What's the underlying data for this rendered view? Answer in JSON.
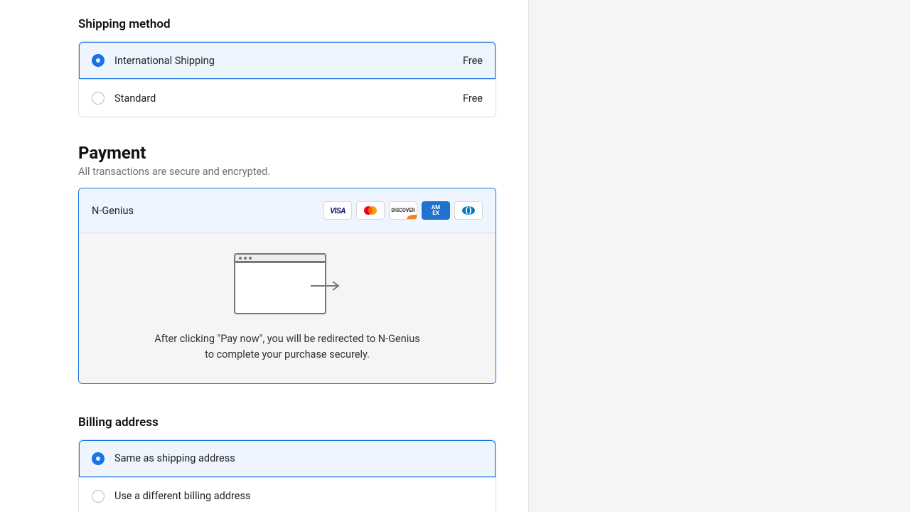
{
  "shipping": {
    "heading": "Shipping method",
    "options": [
      {
        "label": "International Shipping",
        "price": "Free",
        "selected": true
      },
      {
        "label": "Standard",
        "price": "Free",
        "selected": false
      }
    ]
  },
  "payment": {
    "heading": "Payment",
    "subtext": "All transactions are secure and encrypted.",
    "method_name": "N-Genius",
    "redirect_msg": "After clicking \"Pay now\", you will be redirected to N-Genius to complete your purchase securely.",
    "cards": [
      "VISA",
      "mastercard",
      "DISCOVER",
      "AMEX",
      "diners"
    ]
  },
  "billing": {
    "heading": "Billing address",
    "options": [
      {
        "label": "Same as shipping address",
        "selected": true
      },
      {
        "label": "Use a different billing address",
        "selected": false
      }
    ]
  }
}
